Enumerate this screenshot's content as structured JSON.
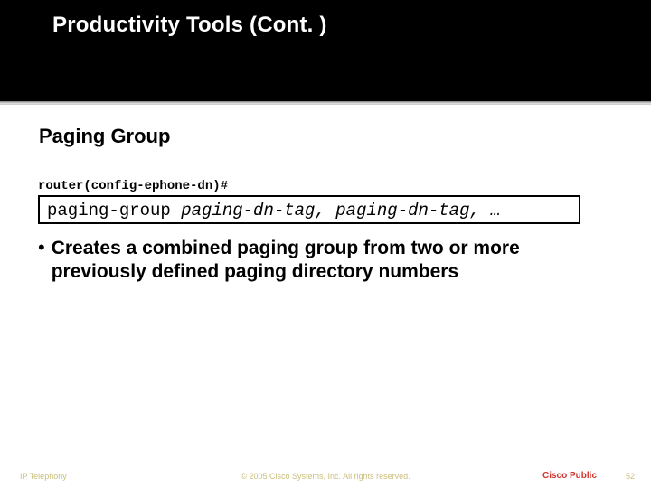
{
  "header": {
    "title": "Productivity Tools (Cont. )"
  },
  "section": {
    "heading": "Paging Group"
  },
  "prompt": {
    "text": "router(config-ephone-dn)#"
  },
  "codebox": {
    "command": "paging-group",
    "args": "paging-dn-tag, paging-dn-tag, …"
  },
  "bullets": [
    "Creates a combined paging group from two or more previously defined paging directory numbers"
  ],
  "footer": {
    "left": "IP Telephony",
    "center": "© 2005 Cisco Systems, Inc. All rights reserved.",
    "right": "Cisco Public",
    "page": "52"
  }
}
